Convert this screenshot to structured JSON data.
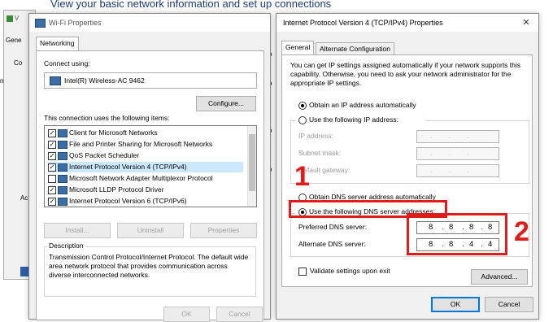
{
  "background": {
    "heading": "View your basic network information and set up connections",
    "fragments": [
      "Gene",
      "Co",
      "Ac",
      "n",
      "o",
      "o",
      "o",
      "o",
      "o",
      "o"
    ]
  },
  "status_window": {
    "title_fragment": "V"
  },
  "wifi_properties": {
    "title": "Wi-Fi Properties",
    "tabs": [
      "Networking"
    ],
    "connect_using_label": "Connect using:",
    "adapter_name": "Intel(R) Wireless-AC 9462",
    "configure_button": "Configure...",
    "items_label": "This connection uses the following items:",
    "items": [
      {
        "label": "Client for Microsoft Networks",
        "checked": true
      },
      {
        "label": "File and Printer Sharing for Microsoft Networks",
        "checked": true
      },
      {
        "label": "QoS Packet Scheduler",
        "checked": true
      },
      {
        "label": "Internet Protocol Version 4 (TCP/IPv4)",
        "checked": true,
        "selected": true
      },
      {
        "label": "Microsoft Network Adapter Multiplexor Protocol",
        "checked": false
      },
      {
        "label": "Microsoft LLDP Protocol Driver",
        "checked": true
      },
      {
        "label": "Internet Protocol Version 6 (TCP/IPv6)",
        "checked": true
      }
    ],
    "install_button": "Install...",
    "uninstall_button": "Uninstall",
    "properties_button": "Properties",
    "description_label": "Description",
    "description_text": "Transmission Control Protocol/Internet Protocol. The default wide area network protocol that provides communication across diverse interconnected networks.",
    "ok_button": "OK",
    "cancel_button": "Cancel"
  },
  "ipv4_properties": {
    "title": "Internet Protocol Version 4 (TCP/IPv4) Properties",
    "close_glyph": "✕",
    "tabs": [
      "General",
      "Alternate Configuration"
    ],
    "intro_text": "You can get IP settings assigned automatically if your network supports this capability. Otherwise, you need to ask your network administrator for the appropriate IP settings.",
    "obtain_ip_auto": "Obtain an IP address automatically",
    "use_following_ip": "Use the following IP address:",
    "ip_address_label": "IP address:",
    "subnet_mask_label": "Subnet mask:",
    "default_gateway_label": "Default gateway:",
    "obtain_dns_auto": "Obtain DNS server address automatically",
    "use_following_dns": "Use the following DNS server addresses:",
    "preferred_dns_label": "Preferred DNS server:",
    "preferred_dns": [
      "8",
      "8",
      "8",
      "8"
    ],
    "alternate_dns_label": "Alternate DNS server:",
    "alternate_dns": [
      "8",
      "8",
      "4",
      "4"
    ],
    "validate_label": "Validate settings upon exit",
    "advanced_button": "Advanced...",
    "ok_button": "OK",
    "cancel_button": "Cancel"
  },
  "annotations": {
    "step1": "1",
    "step2": "2",
    "color": "#e01b1b"
  }
}
